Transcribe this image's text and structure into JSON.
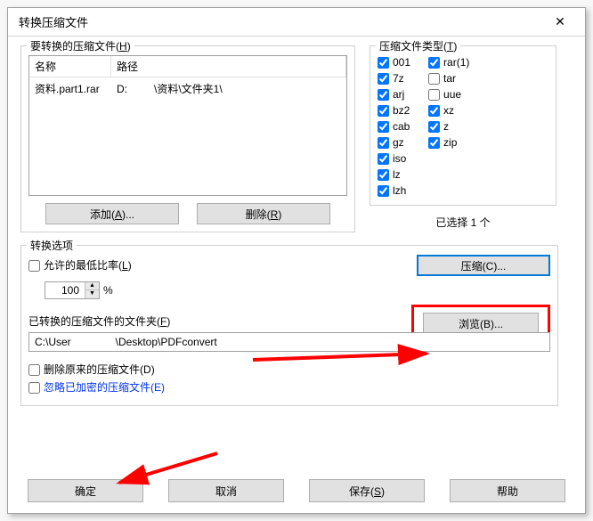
{
  "title": "转换压缩文件",
  "closeGlyph": "✕",
  "filesGroup": {
    "legend": "要转换的压缩文件",
    "legendMn": "H",
    "colName": "名称",
    "colPath": "路径",
    "row": {
      "name": "资料.part1.rar",
      "pathPrefix": "D:",
      "pathSuffix": "\\资料\\文件夹1\\"
    },
    "addLabel": "添加",
    "addMn": "A",
    "addSuffix": "...",
    "delLabel": "删除",
    "delMn": "R"
  },
  "typesGroup": {
    "legend": "压缩文件类型",
    "legendMn": "T",
    "left": [
      "001",
      "7z",
      "arj",
      "bz2",
      "cab",
      "gz",
      "iso",
      "lz",
      "lzh"
    ],
    "right": [
      "rar(1)",
      "tar",
      "uue",
      "xz",
      "z",
      "zip"
    ],
    "selected": "已选择 1 个"
  },
  "options": {
    "legend": "转换选项",
    "minRatio": "允许的最低比率",
    "minRatioMn": "L",
    "ratioVal": "100",
    "pct": "%",
    "compressLabel": "压缩",
    "compressMn": "C",
    "compressSuffix": "...",
    "folderLabel": "已转换的压缩文件的文件夹",
    "folderMn": "F",
    "browseLabel": "浏览",
    "browseMn": "B",
    "browseSuffix": "...",
    "pathPrefix": "C:\\User",
    "pathSuffix": "\\Desktop\\PDFconvert",
    "delOrig": "删除原来的压缩文件",
    "delOrigMn": "D",
    "skipEnc": "忽略已加密的压缩文件",
    "skipEncMn": "E"
  },
  "buttons": {
    "ok": "确定",
    "cancel": "取消",
    "save": "保存",
    "saveMn": "S",
    "help": "帮助"
  }
}
